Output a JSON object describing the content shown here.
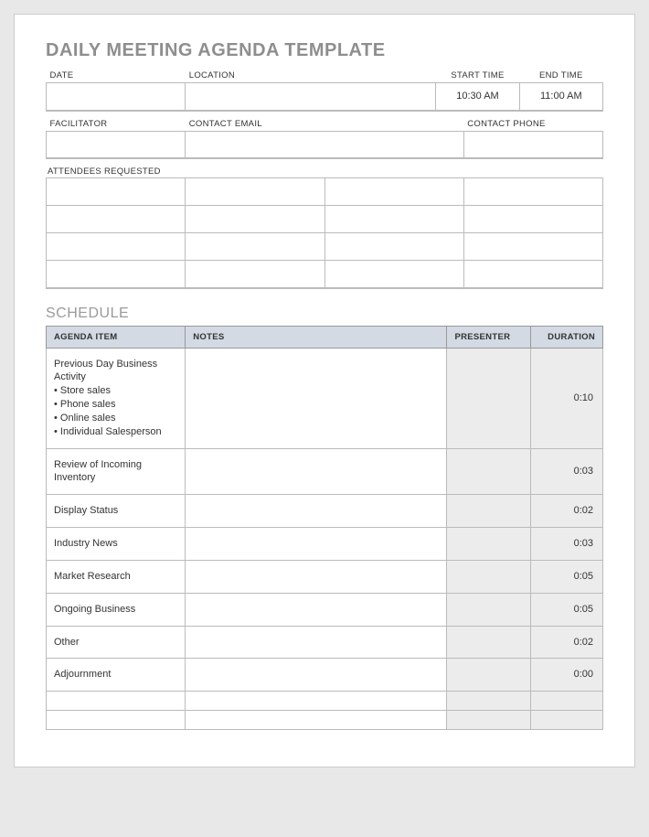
{
  "title": "DAILY MEETING AGENDA TEMPLATE",
  "info1": {
    "headers": {
      "date": "DATE",
      "location": "LOCATION",
      "start": "START TIME",
      "end": "END TIME"
    },
    "values": {
      "date": "",
      "location": "",
      "start": "10:30 AM",
      "end": "11:00 AM"
    }
  },
  "info2": {
    "headers": {
      "facilitator": "FACILITATOR",
      "email": "CONTACT EMAIL",
      "phone": "CONTACT PHONE"
    },
    "values": {
      "facilitator": "",
      "email": "",
      "phone": ""
    }
  },
  "attendees_label": "ATTENDEES REQUESTED",
  "schedule_label": "SCHEDULE",
  "schedule_headers": {
    "item": "AGENDA ITEM",
    "notes": "NOTES",
    "presenter": "PRESENTER",
    "duration": "DURATION"
  },
  "schedule": [
    {
      "item": "Previous Day Business Activity",
      "bullets": [
        "Store sales",
        "Phone sales",
        "Online sales",
        "Individual Salesperson"
      ],
      "notes": "",
      "presenter": "",
      "duration": "0:10"
    },
    {
      "item": "Review of Incoming Inventory",
      "notes": "",
      "presenter": "",
      "duration": "0:03"
    },
    {
      "item": "Display Status",
      "notes": "",
      "presenter": "",
      "duration": "0:02"
    },
    {
      "item": "Industry News",
      "notes": "",
      "presenter": "",
      "duration": "0:03"
    },
    {
      "item": "Market Research",
      "notes": "",
      "presenter": "",
      "duration": "0:05"
    },
    {
      "item": "Ongoing Business",
      "notes": "",
      "presenter": "",
      "duration": "0:05"
    },
    {
      "item": "Other",
      "notes": "",
      "presenter": "",
      "duration": "0:02"
    },
    {
      "item": "Adjournment",
      "notes": "",
      "presenter": "",
      "duration": "0:00"
    },
    {
      "item": "",
      "notes": "",
      "presenter": "",
      "duration": ""
    },
    {
      "item": "",
      "notes": "",
      "presenter": "",
      "duration": ""
    }
  ]
}
